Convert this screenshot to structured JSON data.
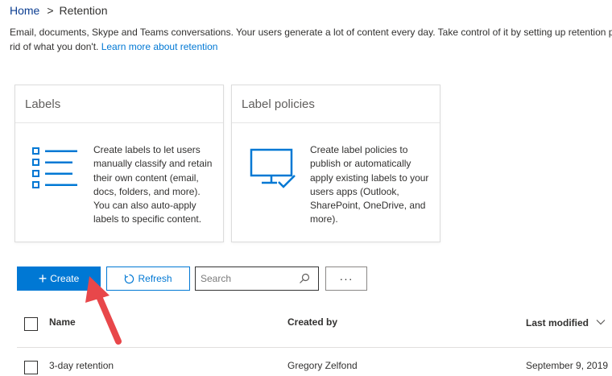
{
  "breadcrumb": {
    "home": "Home",
    "separator": ">",
    "current": "Retention"
  },
  "description": {
    "line1": "Email, documents, Skype and Teams conversations. Your users generate a lot of content every day. Take control of it by setting up retention p",
    "line2_prefix": "rid of what you don't. ",
    "learn_more": "Learn more about retention"
  },
  "cards": {
    "labels": {
      "title": "Labels",
      "text": "Create labels to let users manually classify and retain their own content (email, docs, folders, and more). You can also auto-apply labels to specific content.",
      "icon": "list-icon"
    },
    "label_policies": {
      "title": "Label policies",
      "text": "Create label policies to publish or automatically apply existing labels to your users apps (Outlook, SharePoint, OneDrive, and more).",
      "icon": "monitor-check-icon"
    }
  },
  "toolbar": {
    "create_label": "Create",
    "create_icon": "plus-icon",
    "refresh_label": "Refresh",
    "refresh_icon": "refresh-icon",
    "search_placeholder": "Search",
    "search_icon": "search-icon",
    "more_label": "···"
  },
  "table": {
    "columns": {
      "name": "Name",
      "created_by": "Created by",
      "last_modified": "Last modified"
    },
    "rows": [
      {
        "name": "3-day retention",
        "created_by": "Gregory Zelfond",
        "last_modified": "September 9, 2019"
      }
    ]
  },
  "colors": {
    "accent": "#0078d4",
    "arrow": "#e8474a"
  }
}
